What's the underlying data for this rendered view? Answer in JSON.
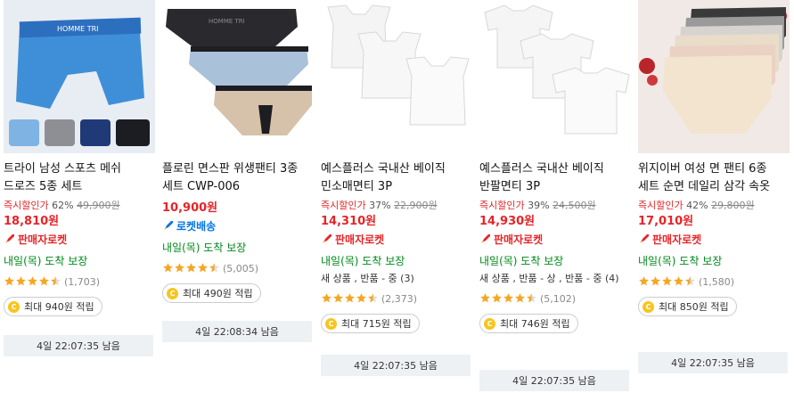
{
  "colors": {
    "price_red": "#e52528",
    "rocket_blue": "#0074e9",
    "delivery_green": "#00891a",
    "star": "#f5a623",
    "coin": "#f7c51e"
  },
  "products": [
    {
      "name": "트라이 남성 스포츠 메쉬 드로즈 5종 세트",
      "discount_label": "즉시할인가",
      "discount_pct": "62%",
      "original_price": "49,900원",
      "price": "18,810원",
      "badge": "판매자로켓",
      "badge_type": "seller-rocket",
      "delivery": "내일(목) 도착 보장",
      "condition": "",
      "rating": 4.5,
      "review_count": "(1,703)",
      "cash": "최대 940원 적립",
      "timer": "4일 22:07:35 남음"
    },
    {
      "name": "플로린 면스판 위생팬티 3종 세트 CWP-006",
      "discount_label": "",
      "discount_pct": "",
      "original_price": "",
      "price": "10,900원",
      "badge": "로켓배송",
      "badge_type": "rocket",
      "delivery": "내일(목) 도착 보장",
      "condition": "",
      "rating": 4.5,
      "review_count": "(5,005)",
      "cash": "최대 490원 적립",
      "timer": "4일 22:08:34 남음"
    },
    {
      "name": "예스플러스 국내산 베이직 민소매면티 3P",
      "discount_label": "즉시할인가",
      "discount_pct": "37%",
      "original_price": "22,900원",
      "price": "14,310원",
      "badge": "판매자로켓",
      "badge_type": "seller-rocket",
      "delivery": "내일(목) 도착 보장",
      "condition": "새 상품 , 반품 - 중 (3)",
      "rating": 4.5,
      "review_count": "(2,373)",
      "cash": "최대 715원 적립",
      "timer": "4일 22:07:35 남음"
    },
    {
      "name": "예스플러스 국내산 베이직 반팔면티 3P",
      "discount_label": "즉시할인가",
      "discount_pct": "39%",
      "original_price": "24,500원",
      "price": "14,930원",
      "badge": "판매자로켓",
      "badge_type": "seller-rocket",
      "delivery": "내일(목) 도착 보장",
      "condition": "새 상품 , 반품 - 상 , 반품 - 중 (4)",
      "rating": 4.5,
      "review_count": "(5,102)",
      "cash": "최대 746원 적립",
      "timer": "4일 22:07:35 남음"
    },
    {
      "name": "위지이버 여성 면 팬티 6종 세트 순면 데일리 삼각 속옷",
      "discount_label": "즉시할인가",
      "discount_pct": "42%",
      "original_price": "29,800원",
      "price": "17,010원",
      "badge": "판매자로켓",
      "badge_type": "seller-rocket",
      "delivery": "내일(목) 도착 보장",
      "condition": "",
      "rating": 4.5,
      "review_count": "(1,580)",
      "cash": "최대 850원 적립",
      "timer": "4일 22:07:35 남음"
    }
  ]
}
